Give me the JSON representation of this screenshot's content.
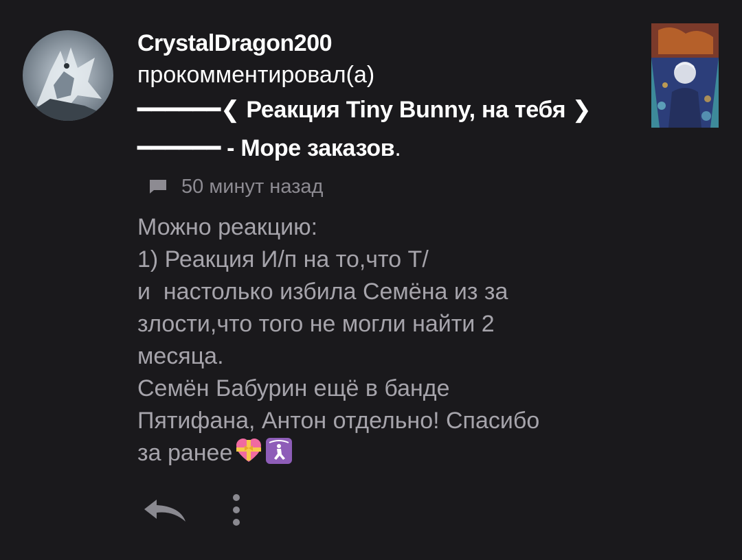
{
  "comment": {
    "username": "CrystalDragon200",
    "action": "прокомментировал(а)",
    "post_title_main": "━━━━━━❮ Реакция Tiny Bunny, на тебя ❯━━━━━━",
    "post_title_suffix": " - Море заказов",
    "post_title_dot": ".",
    "timestamp": "50 минут назад",
    "body_lines": [
      "Можно реакцию:",
      "1) Реакция И/п на то,что Т/",
      "и  настолько избила Семёна из за",
      "злости,что того не могли найти 2",
      "месяца.",
      "Семён Бабурин ещё в банде",
      "Пятифана, Антон отдельно! Спасибо",
      "за ранее"
    ]
  },
  "icons": {
    "avatar": "dragon-avatar",
    "thumbnail": "anime-art-thumbnail",
    "comment": "comment-bubble-icon",
    "reply": "reply-arrow-icon",
    "more": "more-vertical-icon",
    "emoji_1": "heart-with-ribbon-emoji",
    "emoji_2": "person-kneeling-emoji"
  },
  "colors": {
    "background": "#1a191c",
    "username": "#ffffff",
    "body_text": "#a6a4ab",
    "meta_text": "#8d8b92"
  }
}
